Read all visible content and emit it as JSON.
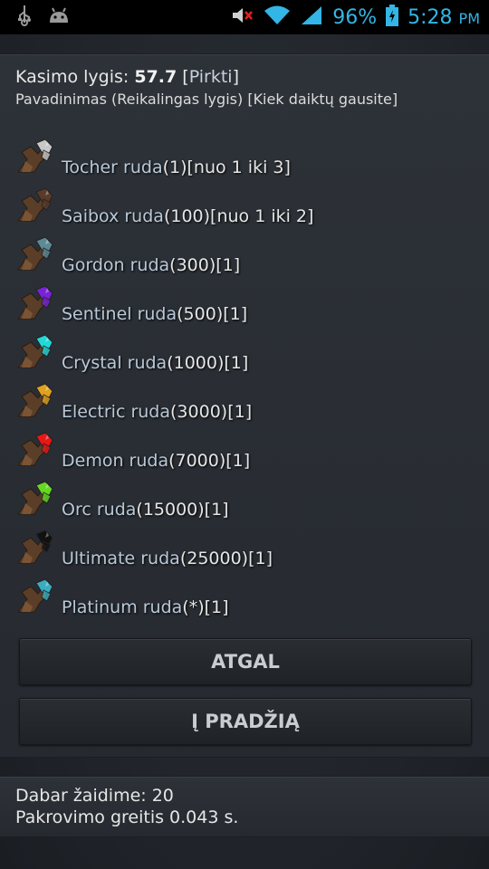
{
  "status_bar": {
    "icons": [
      "usb-icon",
      "android-icon",
      "mute-icon",
      "wifi-icon",
      "signal-icon",
      "battery-icon"
    ],
    "battery": "96%",
    "time": "5:28",
    "ampm": "PM",
    "accent_color": "#33b5e5"
  },
  "header": {
    "level_label": "Kasimo lygis:",
    "level_value": "57.7",
    "buy_open": "[",
    "buy_link": "Pirkti",
    "buy_close": "]",
    "legend": "Pavadinimas (Reikalingas lygis) [Kiek daiktų gausite]"
  },
  "ores": [
    {
      "name": "Tocher ruda",
      "meta": "(1)[nuo 1 iki 3]",
      "color": "#c8c8c8"
    },
    {
      "name": "Saibox ruda",
      "meta": "(100)[nuo 1 iki 2]",
      "color": "#5a3a2a"
    },
    {
      "name": "Gordon ruda",
      "meta": "(300)[1]",
      "color": "#5e8a96"
    },
    {
      "name": "Sentinel ruda",
      "meta": "(500)[1]",
      "color": "#7a22d8"
    },
    {
      "name": "Crystal ruda",
      "meta": "(1000)[1]",
      "color": "#22d8d8"
    },
    {
      "name": "Electric ruda",
      "meta": "(3000)[1]",
      "color": "#e0a020"
    },
    {
      "name": "Demon ruda",
      "meta": "(7000)[1]",
      "color": "#e81818"
    },
    {
      "name": "Orc ruda",
      "meta": "(15000)[1]",
      "color": "#66d822"
    },
    {
      "name": "Ultimate ruda",
      "meta": "(25000)[1]",
      "color": "#111111"
    },
    {
      "name": "Platinum ruda",
      "meta": "(*)[1]",
      "color": "#3aaec0"
    }
  ],
  "buttons": {
    "back": "ATGAL",
    "home": "Į PRADŽIĄ"
  },
  "footer": {
    "online": "Dabar žaidime: 20",
    "load_speed": "Pakrovimo greitis 0.043 s."
  }
}
